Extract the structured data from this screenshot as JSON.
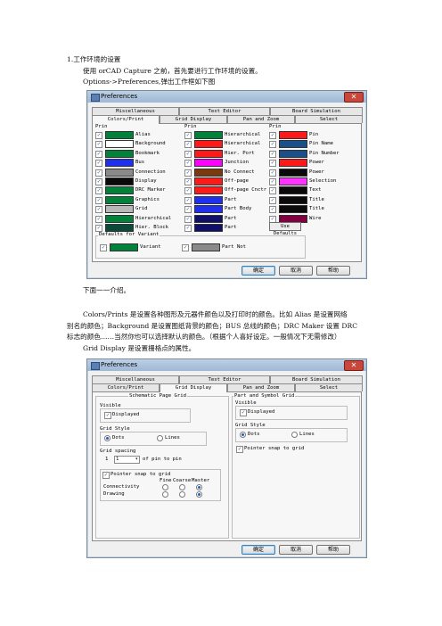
{
  "heading": "1.工作环境的设置",
  "intro_line": "使用 orCAD Capture 之前，首先要进行工作环境的设置。",
  "options_line": "Options->Preferences,弹出工作框如下图",
  "intro_after": "下面一一介绍。",
  "paragraph_lines": [
    "Colors/Prints 是设置各种图形及元器件颜色以及打印时的颜色。比如 Alias 是设置网络",
    "别名的颜色；Background 是设置图纸背景的颜色；BUS 总线的颜色；DRC Maker 设置 DRC",
    "标志的颜色……当然你也可以选择默认的颜色。（根据个人喜好设定。一般情况下无需修改）"
  ],
  "grid_display_line": "Grid Display 是设置栅格点的属性。",
  "dialog1": {
    "title": "Preferences",
    "tabs_row1": [
      "Miscellaneous",
      "Text Editor",
      "Board Simulation"
    ],
    "tabs_row2": [
      "Colors/Print",
      "Grid Display",
      "Pan and Zoom",
      "Select"
    ],
    "col_header": "Prin",
    "colors": {
      "col1": [
        {
          "label": "Alias",
          "color": "#00823b"
        },
        {
          "label": "Background",
          "color": "#ffffff"
        },
        {
          "label": "Bookmark",
          "color": "#00823b"
        },
        {
          "label": "Bus",
          "color": "#1e2ff0"
        },
        {
          "label": "Connection",
          "color": "#8a8a8a"
        },
        {
          "label": "Display",
          "color": "#0a0a0a"
        },
        {
          "label": "DRC Marker",
          "color": "#00823b"
        },
        {
          "label": "Graphics",
          "color": "#00823b"
        },
        {
          "label": "Grid",
          "color": "#b8b8b8"
        },
        {
          "label": "Hierarchical",
          "color": "#00823b"
        },
        {
          "label": "Hier. Block",
          "color": "#0b4a3a"
        }
      ],
      "col2": [
        {
          "label": "Hierarchical",
          "color": "#00823b"
        },
        {
          "label": "Hierarchical",
          "color": "#ff1a1a"
        },
        {
          "label": "Hier. Port",
          "color": "#ff1a1a"
        },
        {
          "label": "Junction",
          "color": "#ff00ff"
        },
        {
          "label": "No Connect",
          "color": "#7a3a10"
        },
        {
          "label": "Off-page",
          "color": "#ff1a1a"
        },
        {
          "label": "Off-page Cnctr",
          "color": "#ff1a1a"
        },
        {
          "label": "Part",
          "color": "#1e2ff0"
        },
        {
          "label": "Part Body",
          "color": "#1e2ff0"
        },
        {
          "label": "Part",
          "color": "#10106a"
        },
        {
          "label": "Part",
          "color": "#10106a"
        }
      ],
      "col3": [
        {
          "label": "Pin",
          "color": "#ff1a1a"
        },
        {
          "label": "Pin Name",
          "color": "#1a4f8a"
        },
        {
          "label": "Pin Number",
          "color": "#1a4f8a"
        },
        {
          "label": "Power",
          "color": "#ff1a1a"
        },
        {
          "label": "Power",
          "color": "#0a0a0a"
        },
        {
          "label": "Selection",
          "color": "#ff33ff"
        },
        {
          "label": "Text",
          "color": "#0a0a0a"
        },
        {
          "label": "Title",
          "color": "#0a0a0a"
        },
        {
          "label": "Title",
          "color": "#0a0a0a"
        },
        {
          "label": "Wire",
          "color": "#800040"
        }
      ]
    },
    "use_defaults": "Use Defaults",
    "variant_group": "Defaults for Variant",
    "variant_label": "Variant",
    "variant_color": "#00823b",
    "fitted_label": "Part Not",
    "fitted_color": "#8a8a8a",
    "buttons": [
      "确定",
      "取消",
      "帮助"
    ]
  },
  "dialog2": {
    "title": "Preferences",
    "tabs_row1": [
      "Miscellaneous",
      "Text Editor",
      "Board Simulation"
    ],
    "tabs_row2": [
      "Colors/Print",
      "Grid Display",
      "Pan and Zoom",
      "Select"
    ],
    "schematic_group": "Schematic Page Grid",
    "visible_label": "Visible",
    "displayed_label": "Displayed",
    "grid_style_label": "Grid Style",
    "dots_label": "Dots",
    "lines_label": "Lines",
    "grid_spacing_label": "Grid spacing",
    "spacing_prefix": "1",
    "spacing_value": "1",
    "spacing_suffix": "of pin to pin",
    "pointer_snap_label": "Pointer snap to grid",
    "snap_headers": [
      "Fine",
      "Coarse",
      "Master"
    ],
    "snap_rows": [
      "Connectivity",
      "Drawing"
    ],
    "part_group": "Part and Symbol Grid",
    "buttons": [
      "确定",
      "取消",
      "帮助"
    ]
  }
}
